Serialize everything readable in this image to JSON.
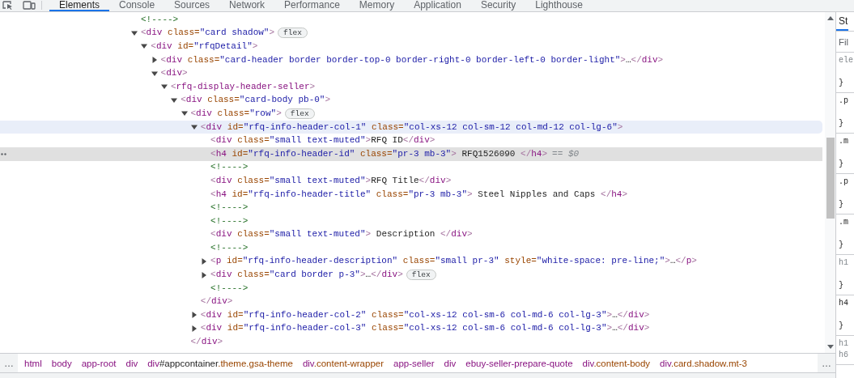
{
  "toolbar": {
    "tabs": [
      {
        "label": "Elements",
        "selected": true
      },
      {
        "label": "Console",
        "selected": false
      },
      {
        "label": "Sources",
        "selected": false
      },
      {
        "label": "Network",
        "selected": false
      },
      {
        "label": "Performance",
        "selected": false
      },
      {
        "label": "Memory",
        "selected": false
      },
      {
        "label": "Application",
        "selected": false
      },
      {
        "label": "Security",
        "selected": false
      },
      {
        "label": "Lighthouse",
        "selected": false
      }
    ]
  },
  "dom_tree": [
    {
      "markup": "<!---->",
      "selected": false,
      "hovered": false
    },
    {
      "markup": "<div class=\"card shadow\">",
      "badge": "flex",
      "expanded": true,
      "selected": false,
      "hovered": false,
      "children": [
        {
          "markup": "<div id=\"rfqDetail\">",
          "expanded": true,
          "selected": false,
          "hovered": false,
          "children": [
            {
              "markup": "<div class=\"card-header border border-top-0 border-right-0 border-left-0 border-light\">…</div>",
              "expanded": false,
              "selected": false,
              "hovered": false
            },
            {
              "markup": "<div>",
              "expanded": true,
              "selected": false,
              "hovered": false,
              "children": [
                {
                  "markup": "<rfq-display-header-seller>",
                  "expanded": true,
                  "selected": false,
                  "hovered": false,
                  "children": [
                    {
                      "markup": "<div class=\"card-body pb-0\">",
                      "expanded": true,
                      "selected": false,
                      "hovered": false,
                      "children": [
                        {
                          "markup": "<div class=\"row\">",
                          "badge": "flex",
                          "expanded": true,
                          "selected": false,
                          "hovered": false,
                          "closing": "</div>",
                          "children": [
                            {
                              "markup": "<div id=\"rfq-info-header-col-1\" class=\"col-xs-12 col-sm-12 col-md-12 col-lg-6\">",
                              "expanded": true,
                              "selected": false,
                              "hovered": true,
                              "closing": "</div>",
                              "children": [
                                {
                                  "markup": "<div class=\"small text-muted\">RFQ ID</div>",
                                  "selected": false,
                                  "hovered": false
                                },
                                {
                                  "markup": "<h4 id=\"rfq-info-header-id\" class=\"pr-3 mb-3\"> RFQ1526090 </h4>",
                                  "console_ref": "== *$0*",
                                  "selected": true,
                                  "hovered": false
                                },
                                {
                                  "markup": "<!---->",
                                  "selected": false,
                                  "hovered": false
                                },
                                {
                                  "markup": "<div class=\"small text-muted\">RFQ Title</div>",
                                  "selected": false,
                                  "hovered": false
                                },
                                {
                                  "markup": "<h4 id=\"rfq-info-header-title\" class=\"pr-3 mb-3\"> Steel Nipples and Caps </h4>",
                                  "selected": false,
                                  "hovered": false
                                },
                                {
                                  "markup": "<!---->",
                                  "selected": false,
                                  "hovered": false
                                },
                                {
                                  "markup": "<!---->",
                                  "selected": false,
                                  "hovered": false
                                },
                                {
                                  "markup": "<div class=\"small text-muted\"> Description </div>",
                                  "selected": false,
                                  "hovered": false
                                },
                                {
                                  "markup": "<!---->",
                                  "selected": false,
                                  "hovered": false
                                },
                                {
                                  "markup": "<p id=\"rfq-info-header-description\" class=\"small pr-3\" style=\"white-space: pre-line;\">…</p>",
                                  "expanded": false,
                                  "selected": false,
                                  "hovered": false
                                },
                                {
                                  "markup": "<div class=\"card border p-3\">…</div>",
                                  "badge": "flex",
                                  "expanded": false,
                                  "selected": false,
                                  "hovered": false
                                },
                                {
                                  "markup": "<!---->",
                                  "selected": false,
                                  "hovered": false
                                }
                              ]
                            },
                            {
                              "markup": "<div id=\"rfq-info-header-col-2\" class=\"col-xs-12 col-sm-6 col-md-6 col-lg-3\">…</div>",
                              "expanded": false,
                              "selected": false,
                              "hovered": false
                            },
                            {
                              "markup": "<div id=\"rfq-info-header-col-3\" class=\"col-xs-12 col-sm-6 col-md-6 col-lg-3\">…</div>",
                              "expanded": false,
                              "selected": false,
                              "hovered": false
                            }
                          ]
                        }
                      ]
                    }
                  ]
                }
              ]
            }
          ]
        }
      ]
    }
  ],
  "breadcrumbs": {
    "scroll_left": "…",
    "scroll_right": "…",
    "items": [
      {
        "tag": "html"
      },
      {
        "tag": "body"
      },
      {
        "tag": "app-root"
      },
      {
        "tag": "div"
      },
      {
        "tag": "div",
        "id": "#appcontainer",
        "classes": ".theme.gsa-theme"
      },
      {
        "tag": "div",
        "classes": ".content-wrapper"
      },
      {
        "tag": "app-seller"
      },
      {
        "tag": "div"
      },
      {
        "tag": "ebuy-seller-prepare-quote"
      },
      {
        "tag": "div",
        "classes": ".content-body"
      },
      {
        "tag": "div",
        "classes": ".card.shadow.mt-3"
      }
    ]
  },
  "styles_pane": {
    "tab": {
      "label": "St",
      "selected": true
    },
    "filter": {
      "placeholder": "Fil"
    },
    "rules": [
      {
        "selectors": [
          {
            "text": "ele",
            "dimmed": true
          }
        ],
        "closing": "}"
      },
      {
        "selectors": [
          {
            "text": ".p",
            "dimmed": false
          }
        ],
        "closing": "}"
      },
      {
        "selectors": [
          {
            "text": ".m",
            "dimmed": false
          }
        ],
        "closing": "}"
      },
      {
        "selectors": [
          {
            "text": ".p",
            "dimmed": false
          }
        ],
        "closing": "}"
      },
      {
        "selectors": [
          {
            "text": ".m",
            "dimmed": false
          }
        ],
        "closing": "}"
      },
      {
        "selectors": [
          {
            "text": "h1",
            "dimmed": true
          }
        ],
        "closing": "}"
      },
      {
        "selectors": [
          {
            "text": "h4",
            "dimmed": false
          }
        ],
        "closing": "}"
      },
      {
        "selectors": [
          {
            "text": "h1",
            "dimmed": true
          },
          {
            "text": "h6",
            "dimmed": true
          }
        ]
      }
    ]
  }
}
